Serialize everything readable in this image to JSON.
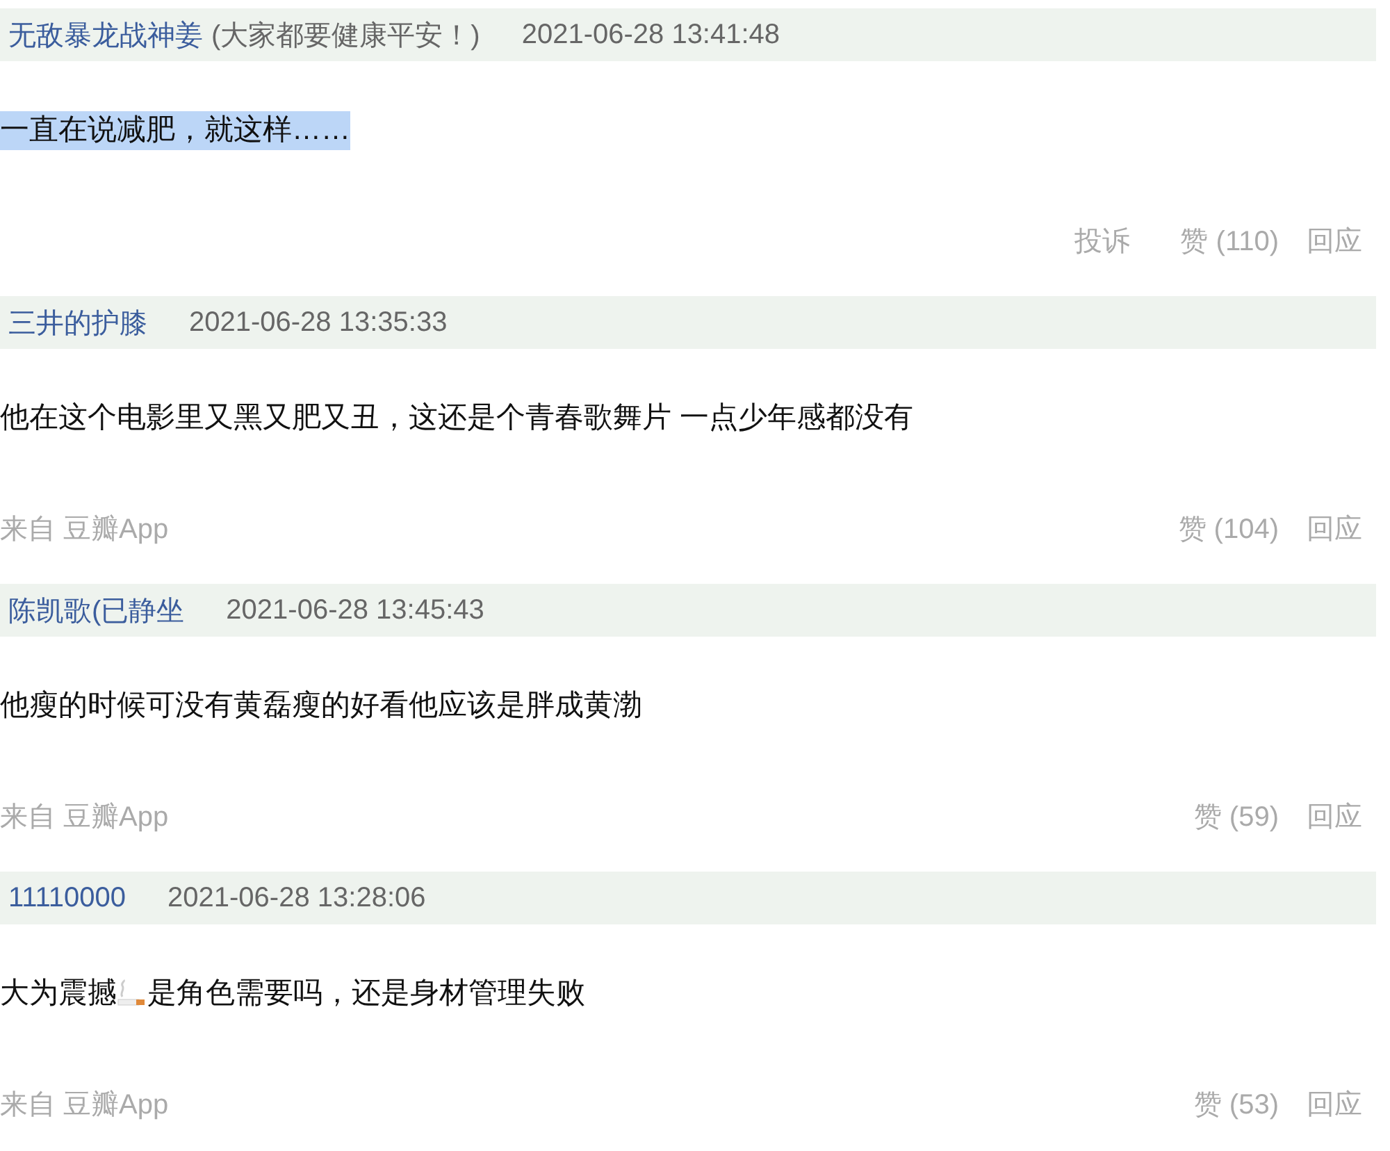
{
  "comments": [
    {
      "user": "无敌暴龙战神姜",
      "note": "(大家都要健康平安！)",
      "time": "2021-06-28 13:41:48",
      "highlighted": true,
      "body": [
        {
          "kind": "text",
          "text": "一直在说减肥，就这样……"
        }
      ],
      "report": "投诉",
      "likes": "赞 (110)",
      "reply": "回应"
    },
    {
      "user": "三井的护膝",
      "time": "2021-06-28 13:35:33",
      "highlighted": false,
      "body": [
        {
          "kind": "text",
          "text": "他在这个电影里又黑又肥又丑，这还是个青春歌舞片 一点少年感都没有"
        }
      ],
      "source": "来自 豆瓣App",
      "likes": "赞 (104)",
      "reply": "回应"
    },
    {
      "user": "陈凯歌(已静坐",
      "time": "2021-06-28 13:45:43",
      "highlighted": false,
      "body": [
        {
          "kind": "text",
          "text": "他瘦的时候可没有黄磊瘦的好看他应该是胖成黄渤"
        }
      ],
      "source": "来自 豆瓣App",
      "likes": "赞 (59)",
      "reply": "回应"
    },
    {
      "user": "11110000",
      "time": "2021-06-28 13:28:06",
      "highlighted": false,
      "body": [
        {
          "kind": "text",
          "text": "大为震撼"
        },
        {
          "kind": "emoji"
        },
        {
          "kind": "text",
          "text": "是角色需要吗，还是身材管理失败"
        }
      ],
      "source": "来自 豆瓣App",
      "likes": "赞 (53)",
      "reply": "回应"
    }
  ]
}
